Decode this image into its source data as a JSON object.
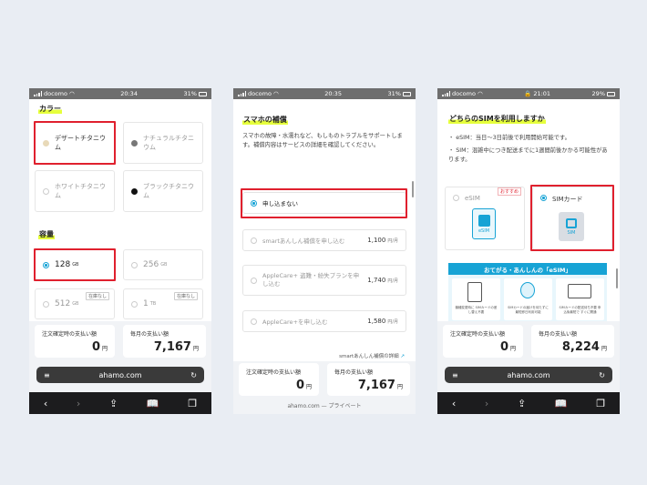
{
  "phones": [
    {
      "status": {
        "carrier": "docomo",
        "time": "20:34",
        "battery": "31%"
      },
      "color_title": "カラー",
      "colors": [
        {
          "label": "デザートチタニウム",
          "swatch": "#e8d9b8",
          "selected": true
        },
        {
          "label": "ナチュラルチタニウム",
          "swatch": "#777777",
          "selected": false
        },
        {
          "label": "ホワイトチタニウム",
          "swatch": "#ffffff",
          "selected": false
        },
        {
          "label": "ブラックチタニウム",
          "swatch": "#111111",
          "selected": false
        }
      ],
      "capacity_title": "容量",
      "capacities": [
        {
          "value": "128",
          "unit": "GB",
          "selected": true,
          "badge": ""
        },
        {
          "value": "256",
          "unit": "GB",
          "selected": false,
          "badge": ""
        },
        {
          "value": "512",
          "unit": "GB",
          "selected": false,
          "badge": "在庫なし"
        },
        {
          "value": "1",
          "unit": "TB",
          "selected": false,
          "badge": "在庫なし"
        }
      ],
      "price": {
        "order_label": "注文確定時の支払い額",
        "order_value": "0",
        "monthly_label": "毎月の支払い額",
        "monthly_value": "7,167",
        "unit": "円"
      },
      "url": "ahamo.com"
    },
    {
      "status": {
        "carrier": "docomo",
        "time": "20:35",
        "battery": "31%"
      },
      "title": "スマホの補償",
      "description": "スマホの故障・水濡れなど、もしものトラブルをサポートします。補償内容はサービスの詳細を確認してください。",
      "options": [
        {
          "label": "申し込まない",
          "price": "",
          "selected": true
        },
        {
          "label": "smartあんしん補償を申し込む",
          "price": "1,100",
          "selected": false
        },
        {
          "label": "AppleCare+ 盗難・紛失プランを申し込む",
          "price": "1,740",
          "selected": false
        },
        {
          "label": "AppleCare+を申し込む",
          "price": "1,580",
          "selected": false
        }
      ],
      "price_unit_month": "円/月",
      "details_link": "smartあんしん補償の詳細",
      "price": {
        "order_label": "注文確定時の支払い額",
        "order_value": "0",
        "monthly_label": "毎月の支払い額",
        "monthly_value": "7,167",
        "unit": "円"
      },
      "footer_url": "ahamo.com — プライベート"
    },
    {
      "status": {
        "carrier": "docomo",
        "time": "21:01",
        "battery": "29%"
      },
      "title": "どちらのSIMを利用しますか",
      "bullets": [
        "・ eSIM：当日〜3日前後で利用開始可能です。",
        "・ SIM：混雑中につき配送までに1週間前後かかる可能性があります。"
      ],
      "esim_label": "eSIM",
      "esim_badge": "おすすめ",
      "esim_icon_text": "eSIM",
      "sim_label": "SIMカード",
      "sim_icon_text": "SIM",
      "banner_title": "おてがる・あんしんの「eSIM」",
      "banner_captions": [
        "機種変更時に SIMカードの差し替え不要",
        "SIMカードの届けを待たずに 最短即日利用可能",
        "SIMカードの配送待ち不要 申込後最短で すぐに開通"
      ],
      "price": {
        "order_label": "注文確定時の支払い額",
        "order_value": "0",
        "monthly_label": "毎月の支払い額",
        "monthly_value": "8,224",
        "unit": "円"
      },
      "url": "ahamo.com"
    }
  ],
  "icons": {
    "back": "‹",
    "forward": "›",
    "share": "⇪",
    "bookmarks": "📖",
    "tabs": "❐",
    "reload": "↻",
    "reader": "≡"
  },
  "accent": "#17a3d5",
  "highlight_red": "#e0202e"
}
